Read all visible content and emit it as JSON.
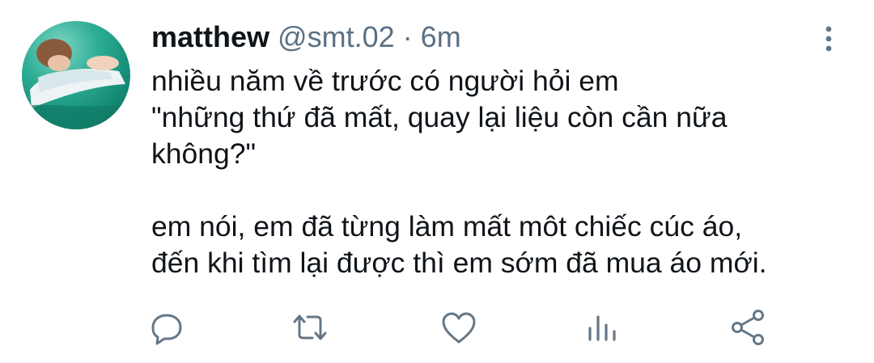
{
  "tweet": {
    "author_name": "matthew",
    "handle": "@smt.02",
    "separator": "·",
    "time": "6m",
    "lines": [
      "nhiều năm về trước có người hỏi em",
      "\"những thứ đã mất, quay lại liệu còn cần nữa",
      "không?\"",
      "em nói, em đã từng làm mất môt chiếc cúc áo,",
      "đến khi tìm lại được thì em sớm đã mua áo mới."
    ]
  },
  "icons": {
    "more": "more-vertical-icon",
    "reply": "reply-icon",
    "retweet": "retweet-icon",
    "like": "heart-icon",
    "analytics": "analytics-icon",
    "share": "share-icon"
  },
  "colors": {
    "text": "#0f1419",
    "secondary": "#5b7083",
    "icon": "#657786",
    "background": "#ffffff"
  }
}
